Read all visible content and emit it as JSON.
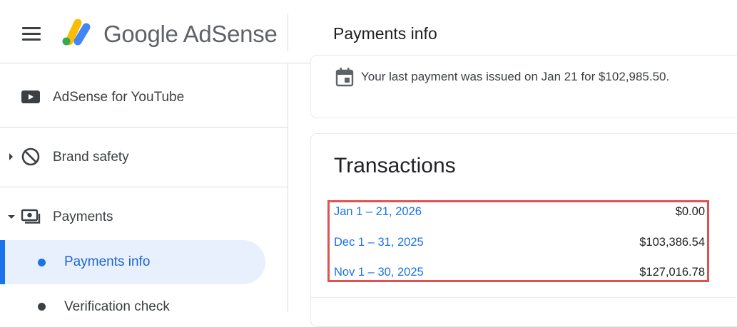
{
  "header": {
    "brand": "Google AdSense",
    "page_title": "Payments info",
    "icons": {
      "menu": "hamburger-menu-icon",
      "logo": "adsense-logo-icon"
    }
  },
  "sidebar": {
    "items": [
      {
        "label": "AdSense for YouTube",
        "icon": "youtube-icon"
      },
      {
        "label": "Brand safety",
        "icon": "block-icon",
        "expandable": true,
        "expanded": false
      },
      {
        "label": "Payments",
        "icon": "payments-icon",
        "expandable": true,
        "expanded": true
      },
      {
        "label": "Payments info",
        "active": true
      },
      {
        "label": "Verification check"
      }
    ]
  },
  "notice": {
    "icon": "calendar-icon",
    "text": "Your last payment was issued on Jan 21 for $102,985.50."
  },
  "transactions": {
    "title": "Transactions",
    "rows": [
      {
        "period": "Jan 1 – 21, 2026",
        "amount": "$0.00"
      },
      {
        "period": "Dec 1 – 31, 2025",
        "amount": "$103,386.54"
      },
      {
        "period": "Nov 1 – 30, 2025",
        "amount": "$127,016.78"
      }
    ]
  },
  "colors": {
    "accent": "#1a73e8",
    "active_bg": "#e8f0fe",
    "highlight_border": "#e05252",
    "logo_yellow": "#fbbc04",
    "logo_blue": "#4285f4",
    "logo_green": "#34a853"
  }
}
